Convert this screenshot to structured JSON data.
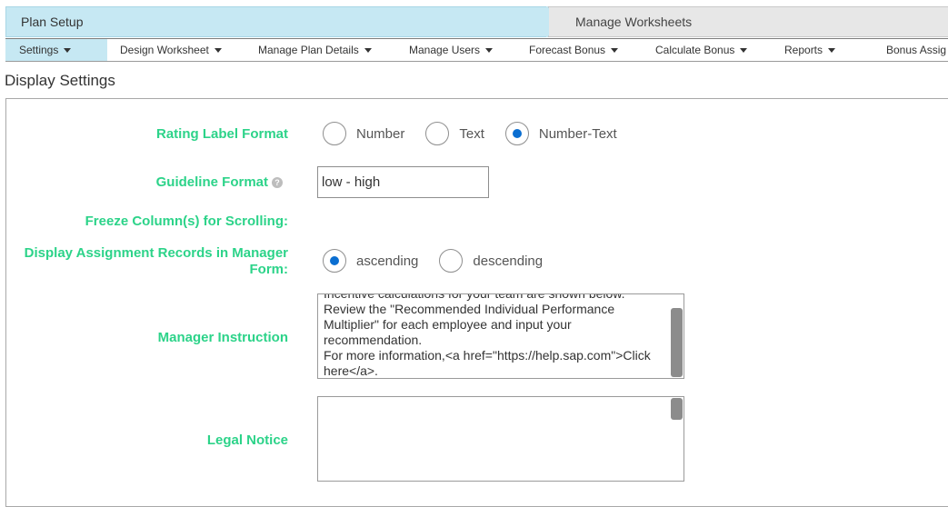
{
  "breadcrumb": {
    "step1": "Plan Setup",
    "step2": "Manage Worksheets"
  },
  "menu": {
    "items": [
      {
        "label": "Settings"
      },
      {
        "label": "Design Worksheet"
      },
      {
        "label": "Manage Plan Details"
      },
      {
        "label": "Manage Users"
      },
      {
        "label": "Forecast Bonus"
      },
      {
        "label": "Calculate Bonus"
      },
      {
        "label": "Reports"
      },
      {
        "label": "Bonus Assig"
      }
    ]
  },
  "page": {
    "title": "Display Settings"
  },
  "form": {
    "rating_label_format": {
      "label": "Rating Label Format",
      "options": [
        "Number",
        "Text",
        "Number-Text"
      ],
      "selected": "Number-Text"
    },
    "guideline_format": {
      "label": "Guideline Format",
      "value": "low - high",
      "help_icon": "question-circle-icon"
    },
    "freeze_columns": {
      "label": "Freeze Column(s) for Scrolling:"
    },
    "display_assignment": {
      "label_line1": "Display Assignment Records in Manager",
      "label_line2": "Form:",
      "options": [
        "ascending",
        "descending"
      ],
      "selected": "ascending"
    },
    "manager_instruction": {
      "label": "Manager Instruction",
      "value": "Incentive calculations for your team are shown below.\nReview the \"Recommended Individual Performance Multiplier\" for each employee and input your recommendation.\nFor more information,<a href=\"https://help.sap.com\">Click here</a>."
    },
    "legal_notice": {
      "label": "Legal Notice",
      "value": ""
    }
  },
  "colors": {
    "label_green": "#2cd389",
    "radio_selected": "#0a6ed1",
    "breadcrumb_active": "#c6e8f3"
  }
}
